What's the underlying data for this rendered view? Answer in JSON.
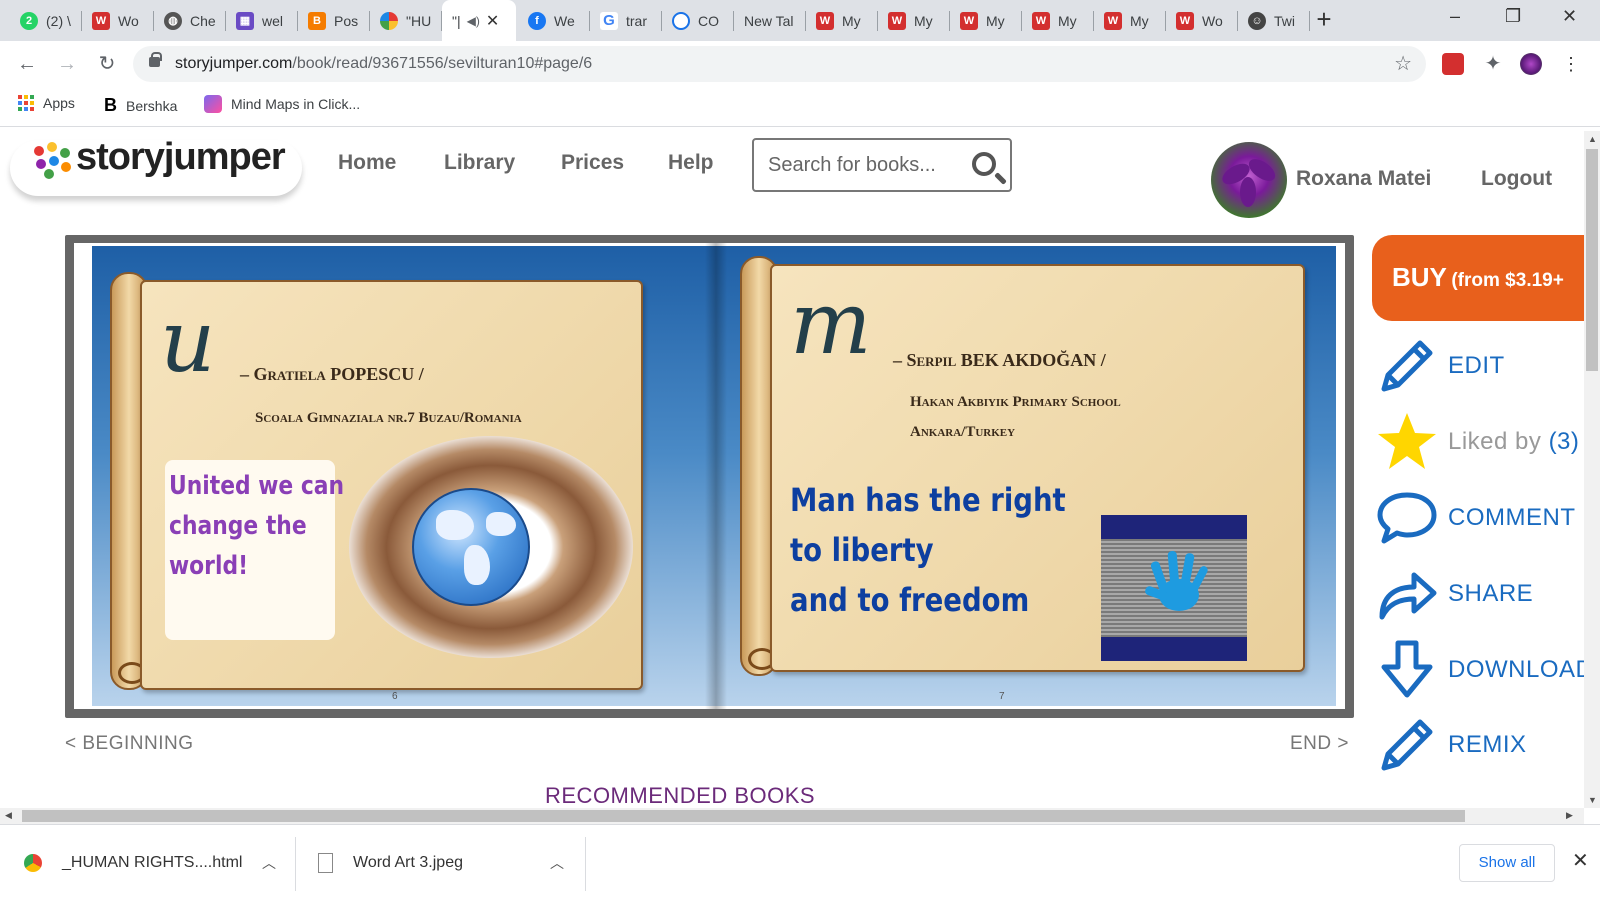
{
  "browser": {
    "tabs": [
      {
        "label": "(2) \\",
        "icon": "whatsapp-icon",
        "color": "#25d366"
      },
      {
        "label": "Wo",
        "icon": "word-art-icon",
        "color": "#d32f2f"
      },
      {
        "label": "Che",
        "icon": "globe-icon",
        "color": "#555555"
      },
      {
        "label": "wel",
        "icon": "image-icon",
        "color": "#6a4bc4"
      },
      {
        "label": "Pos",
        "icon": "blogger-icon",
        "color": "#f57c00"
      },
      {
        "label": "\"HU",
        "icon": "storyjumper-icon",
        "color": "#e53935"
      },
      {
        "label": "\"|",
        "icon": "speaker-icon",
        "color": "#5f6368"
      },
      {
        "label": "We",
        "icon": "facebook-icon",
        "color": "#1877f2"
      },
      {
        "label": "trar",
        "icon": "google-icon",
        "color": "#4285f4"
      },
      {
        "label": "CO",
        "icon": "circle-logo-icon",
        "color": "#1a73e8"
      },
      {
        "label": "New Tal",
        "icon": "",
        "color": ""
      },
      {
        "label": "My",
        "icon": "word-art-icon",
        "color": "#d32f2f"
      },
      {
        "label": "My",
        "icon": "word-art-icon",
        "color": "#d32f2f"
      },
      {
        "label": "My",
        "icon": "word-art-icon",
        "color": "#d32f2f"
      },
      {
        "label": "My",
        "icon": "word-art-icon",
        "color": "#d32f2f"
      },
      {
        "label": "My",
        "icon": "word-art-icon",
        "color": "#d32f2f"
      },
      {
        "label": "Wo",
        "icon": "word-art-icon",
        "color": "#d32f2f"
      },
      {
        "label": "Twi",
        "icon": "face-icon",
        "color": "#444444"
      }
    ],
    "new_tab": "+",
    "window_controls": {
      "minimize": "–",
      "restore": "❐",
      "close": "✕"
    },
    "url_host": "storyjumper.com",
    "url_path": "/book/read/93671556/sevilturan10#page/6",
    "bookmarks": [
      {
        "label": "Apps",
        "icon": "apps-grid-icon"
      },
      {
        "label": "Bershka",
        "icon": "bershka-icon"
      },
      {
        "label": "Mind Maps in Click...",
        "icon": "clickup-icon"
      }
    ]
  },
  "site": {
    "logo_text_story": "story",
    "logo_text_jumper": "jumper",
    "nav": [
      "Home",
      "Library",
      "Prices",
      "Help"
    ],
    "search_placeholder": "Search for books...",
    "user_name": "Roxana Matei",
    "logout": "Logout"
  },
  "book": {
    "left_page": {
      "letter": "u",
      "author": "– Gratiela POPESCU /",
      "school": "Scoala Gimnaziala nr.7 Buzau/Romania",
      "slogan": [
        "United we can",
        "change the",
        "world!"
      ],
      "page_number": "6"
    },
    "right_page": {
      "letter": "m",
      "author": "– Serpil BEK AKDOĞAN /",
      "school_line1": "Hakan Akbiyik Primary School",
      "school_line2": "Ankara/Turkey",
      "slogan": [
        "Man has the right",
        "to liberty",
        "and to freedom"
      ],
      "page_number": "7"
    },
    "nav_beginning": "< BEGINNING",
    "nav_end": "END >",
    "recommended": "RECOMMENDED BOOKS"
  },
  "actions": {
    "buy_big": "BUY",
    "buy_small": "(from $3.19+",
    "edit": "EDIT",
    "liked_by": "Liked by",
    "liked_count": "(3)",
    "comment": "COMMENT",
    "share": "SHARE",
    "download": "DOWNLOAD",
    "remix": "REMIX"
  },
  "downloads": {
    "items": [
      "_HUMAN RIGHTS....html",
      "Word Art 3.jpeg"
    ],
    "show_all": "Show all"
  },
  "colors": {
    "accent_blue": "#1a6bc0",
    "buy_orange": "#e8601c",
    "slogan_purple": "#8a3fb6",
    "slogan_blue": "#0d3fa0"
  }
}
